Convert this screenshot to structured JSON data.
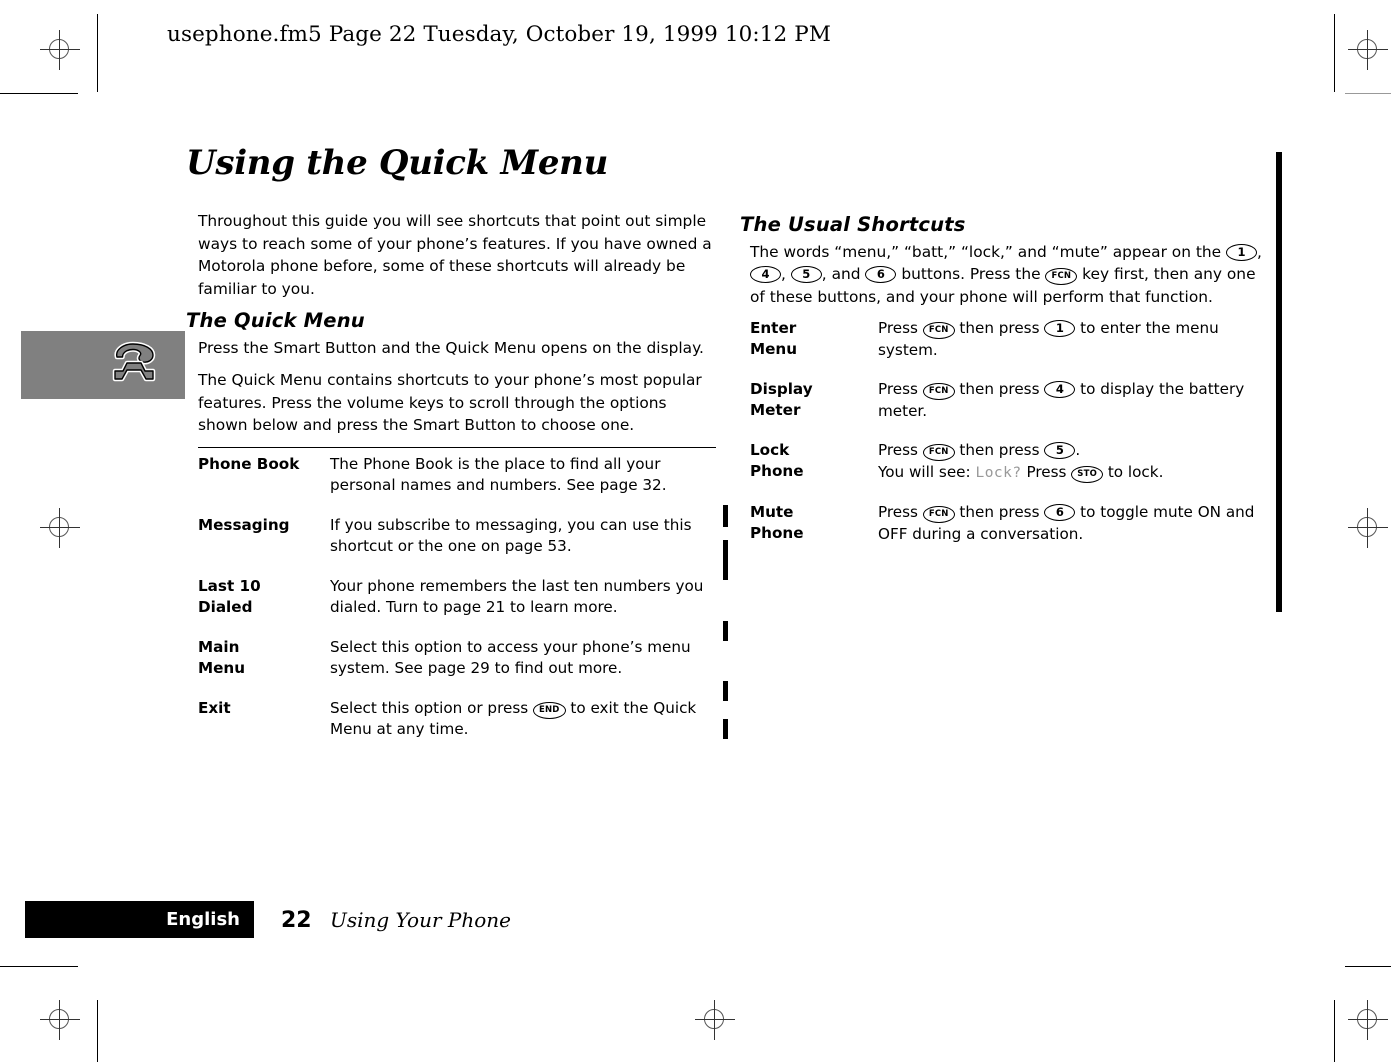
{
  "doc": {
    "header_line": "usephone.fm5  Page 22  Tuesday, October 19, 1999  10:12 PM",
    "title": "Using the Quick Menu"
  },
  "left_column": {
    "intro": "Throughout this guide you will see shortcuts that point out simple ways to reach some of your phone’s features. If you have owned a Motorola phone before, some of these shortcuts will already be familiar to you.",
    "section_heading": "The Quick Menu",
    "para1": "Press the Smart Button and the Quick Menu opens on the display.",
    "para2": "The Quick Menu contains shortcuts to your phone’s most popular features. Press the volume keys to scroll through the options shown below and press the Smart Button to choose one.",
    "table": [
      {
        "term": "Phone Book",
        "desc": "The Phone Book is the place to find all your personal names and numbers. See page 32."
      },
      {
        "term": "Messaging",
        "desc": "If you subscribe to messaging, you can use this shortcut or the one on page 53."
      },
      {
        "term": "Last 10\nDialed",
        "desc": "Your phone remembers the last ten numbers you dialed. Turn to page 21 to learn more."
      },
      {
        "term": "Main\nMenu",
        "desc": "Select this option to access your phone’s menu system. See page 29 to find out more."
      },
      {
        "term": "Exit",
        "desc_before": "Select this option or press ",
        "key": "END",
        "desc_after": " to exit the Quick Menu at any time."
      }
    ]
  },
  "right_column": {
    "section_heading": "The Usual Shortcuts",
    "intro_1": "The words “menu,” “batt,” “lock,” and “mute” appear on the ",
    "intro_keys": [
      "1",
      "4",
      "5",
      "6"
    ],
    "intro_2": " buttons. Press the ",
    "intro_fcn": "FCN",
    "intro_3": " key first, then any one of these buttons, and your phone will perform that function.",
    "intro_sep_1": ", ",
    "intro_sep_2": ", ",
    "intro_sep_3": ", and ",
    "table": [
      {
        "term": "Enter\nMenu",
        "p1": "Press ",
        "k1": "FCN",
        "p2": " then press ",
        "k2": "1",
        "p3": " to enter the menu system."
      },
      {
        "term": "Display\nMeter",
        "p1": "Press ",
        "k1": "FCN",
        "p2": " then press ",
        "k2": "4",
        "p3": " to display the battery meter."
      },
      {
        "term": "Lock\nPhone",
        "p1": "Press ",
        "k1": "FCN",
        "p2": " then press ",
        "k2": "5",
        "p3": ".",
        "line2_a": "You will see: ",
        "lcd": "Lock?",
        "line2_b": " Press ",
        "k3": "STO",
        "line2_c": " to lock."
      },
      {
        "term": "Mute\nPhone",
        "p1": "Press ",
        "k1": "FCN",
        "p2": " then press ",
        "k2": "6",
        "p3": " to toggle mute ON and OFF during a conversation."
      }
    ]
  },
  "footer": {
    "language": "English",
    "page_number": "22",
    "section": "Using Your Phone"
  },
  "colors": {
    "icon_box_bg": "#808080",
    "footer_bar_bg": "#000000",
    "lcd_text": "#999999"
  }
}
